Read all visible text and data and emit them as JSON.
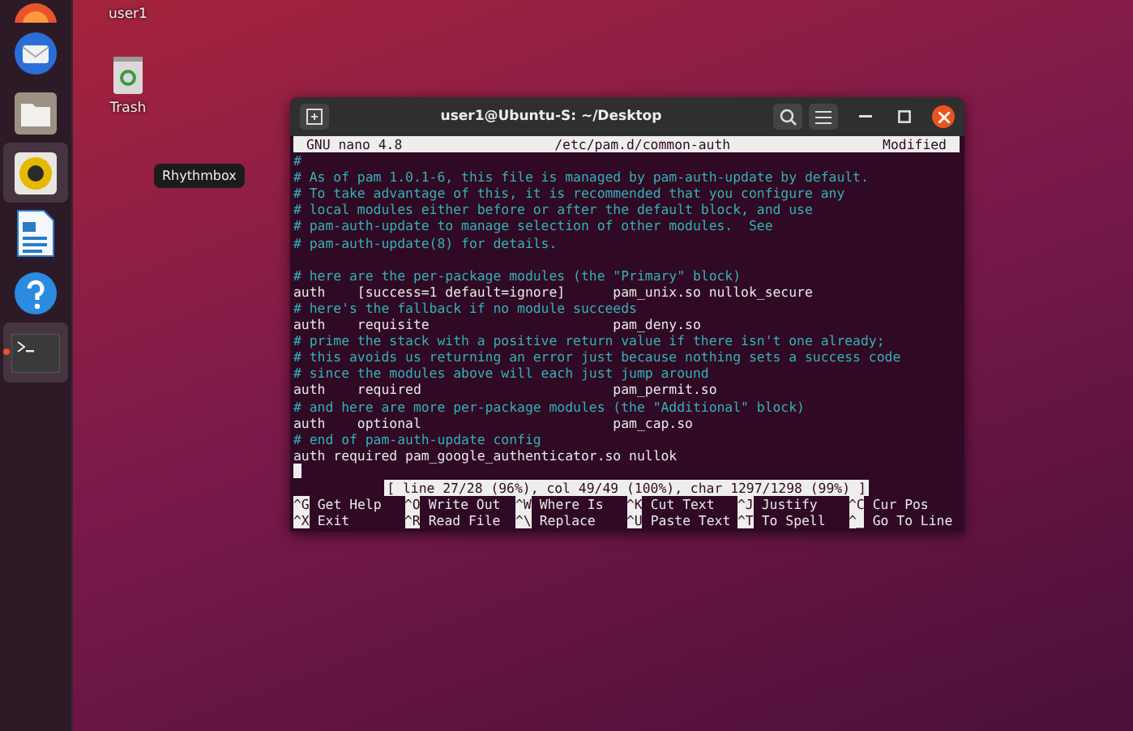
{
  "dock": {
    "items": [
      {
        "kind": "browser",
        "active": false
      },
      {
        "kind": "mail",
        "active": false
      },
      {
        "kind": "files",
        "active": false
      },
      {
        "kind": "music",
        "active": false,
        "hovered": true
      },
      {
        "kind": "writer",
        "active": false
      },
      {
        "kind": "help",
        "active": false
      },
      {
        "kind": "terminal",
        "active": true
      }
    ]
  },
  "tooltip": "Rhythmbox",
  "desktop_icons": [
    {
      "kind": "home",
      "label": "user1"
    },
    {
      "kind": "trash",
      "label": "Trash"
    }
  ],
  "window": {
    "title": "user1@Ubuntu-S: ~/Desktop",
    "nano": {
      "version": "GNU nano 4.8",
      "file": "/etc/pam.d/common-auth",
      "state": "Modified",
      "lines": [
        {
          "kind": "comment",
          "text": "#"
        },
        {
          "kind": "comment",
          "text": "# As of pam 1.0.1-6, this file is managed by pam-auth-update by default."
        },
        {
          "kind": "comment",
          "text": "# To take advantage of this, it is recommended that you configure any"
        },
        {
          "kind": "comment",
          "text": "# local modules either before or after the default block, and use"
        },
        {
          "kind": "comment",
          "text": "# pam-auth-update to manage selection of other modules.  See"
        },
        {
          "kind": "comment",
          "text": "# pam-auth-update(8) for details."
        },
        {
          "kind": "blank"
        },
        {
          "kind": "comment",
          "text": "# here are the per-package modules (the \"Primary\" block)"
        },
        {
          "kind": "code",
          "text": "auth    [success=1 default=ignore]      pam_unix.so nullok_secure"
        },
        {
          "kind": "comment",
          "text": "# here's the fallback if no module succeeds"
        },
        {
          "kind": "code",
          "text": "auth    requisite                       pam_deny.so"
        },
        {
          "kind": "comment",
          "text": "# prime the stack with a positive return value if there isn't one already;"
        },
        {
          "kind": "comment",
          "text": "# this avoids us returning an error just because nothing sets a success code"
        },
        {
          "kind": "comment",
          "text": "# since the modules above will each just jump around"
        },
        {
          "kind": "code",
          "text": "auth    required                        pam_permit.so"
        },
        {
          "kind": "comment",
          "text": "# and here are more per-package modules (the \"Additional\" block)"
        },
        {
          "kind": "code",
          "text": "auth    optional                        pam_cap.so"
        },
        {
          "kind": "comment",
          "text": "# end of pam-auth-update config"
        },
        {
          "kind": "code",
          "text": "auth required pam_google_authenticator.so nullok"
        },
        {
          "kind": "cursor"
        }
      ],
      "status": "[ line 27/28 (96%), col 49/49 (100%), char 1297/1298 (99%) ]",
      "shortcuts": [
        [
          {
            "key": "^G",
            "label": "Get Help"
          },
          {
            "key": "^O",
            "label": "Write Out"
          },
          {
            "key": "^W",
            "label": "Where Is"
          },
          {
            "key": "^K",
            "label": "Cut Text"
          },
          {
            "key": "^J",
            "label": "Justify"
          },
          {
            "key": "^C",
            "label": "Cur Pos"
          }
        ],
        [
          {
            "key": "^X",
            "label": "Exit"
          },
          {
            "key": "^R",
            "label": "Read File"
          },
          {
            "key": "^\\",
            "label": "Replace"
          },
          {
            "key": "^U",
            "label": "Paste Text"
          },
          {
            "key": "^T",
            "label": "To Spell"
          },
          {
            "key": "^_",
            "label": "Go To Line"
          }
        ]
      ]
    }
  }
}
